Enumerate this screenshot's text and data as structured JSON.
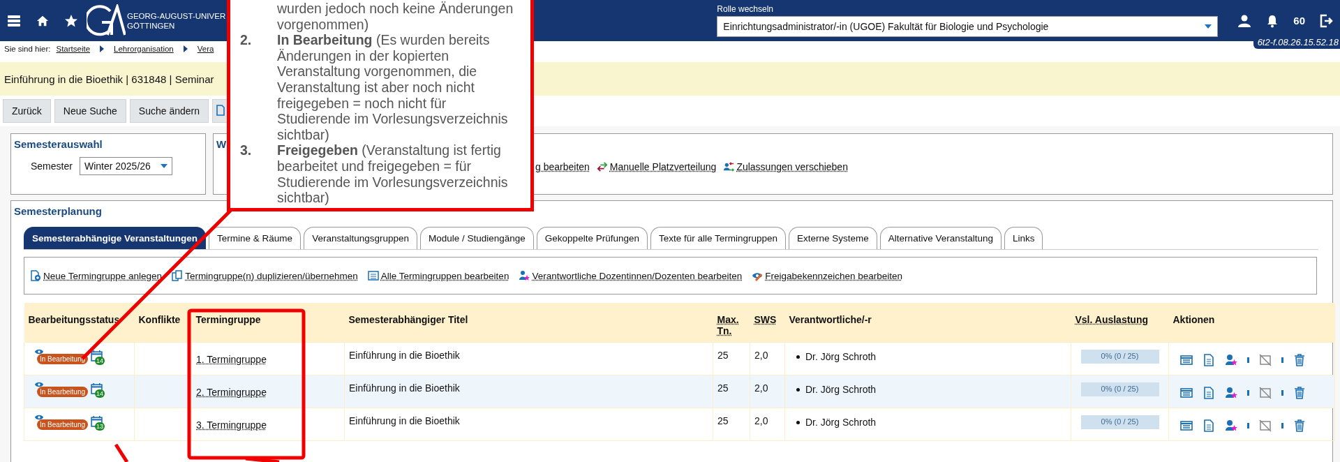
{
  "header": {
    "university_lines": [
      "GEORG-AUGUST-UNIVER",
      "GÖTTINGEN"
    ],
    "role_label": "Rolle wechseln",
    "role_value": "Einrichtungsadministrator/-in (UGOE) Fakultät für Biologie und Psychologie",
    "notification_count": "60",
    "version": "6t2-f.08.26.15.52.18"
  },
  "breadcrumb": {
    "label": "Sie sind hier:",
    "items": [
      "Startseite",
      "Lehrorganisation",
      "Vera"
    ]
  },
  "title": "Einführung in die Bioethik | 631848 | Seminar",
  "buttons": [
    "Zurück",
    "Neue Suche",
    "Suche ändern"
  ],
  "semester_box": {
    "title": "Semesterauswahl",
    "label": "Semester",
    "value": "Winter 2025/26"
  },
  "second_box": {
    "title": "W",
    "links": [
      {
        "label": "g bearbeiten",
        "kind": "plain"
      },
      {
        "label": "Manuelle Platzverteilung",
        "kind": "swap"
      },
      {
        "label": "Zulassungen verschieben",
        "kind": "move"
      }
    ]
  },
  "planning": {
    "title": "Semesterplanung",
    "tabs": [
      {
        "label": "Semesterabhängige Veranstaltungen",
        "selected": true
      },
      {
        "label": "Termine & Räume",
        "selected": false
      },
      {
        "label": "Veranstaltungsgruppen",
        "selected": false
      },
      {
        "label": "Module / Studiengänge",
        "selected": false
      },
      {
        "label": "Gekoppelte Prüfungen",
        "selected": false
      },
      {
        "label": "Texte für alle Termingruppen",
        "selected": false
      },
      {
        "label": "Externe Systeme",
        "selected": false
      },
      {
        "label": "Alternative Veranstaltung",
        "selected": false
      },
      {
        "label": "Links",
        "selected": false
      }
    ],
    "actions": [
      {
        "label": "Neue Termingruppe anlegen",
        "kind": "new"
      },
      {
        "label": "Termingruppe(n) duplizieren/übernehmen",
        "kind": "copy"
      },
      {
        "label": "Alle Termingruppen bearbeiten",
        "kind": "list"
      },
      {
        "label": "Verantwortliche Dozentinnen/Dozenten bearbeiten",
        "kind": "person"
      },
      {
        "label": "Freigabekennzeichen bearbeiten",
        "kind": "release"
      }
    ]
  },
  "table": {
    "columns": [
      {
        "label": "Bearbeitungsstatus",
        "abbr": false
      },
      {
        "label": "Konflikte",
        "abbr": false
      },
      {
        "label": "Termingruppe",
        "abbr": false
      },
      {
        "label": "Semesterabhängiger Titel",
        "abbr": false
      },
      {
        "label": "Max. Tn.",
        "abbr": true
      },
      {
        "label": "SWS",
        "abbr": true
      },
      {
        "label": "Verantwortliche/-r",
        "abbr": false
      },
      {
        "label": "Vsl. Auslastung",
        "abbr": true
      },
      {
        "label": "Aktionen",
        "abbr": false
      }
    ],
    "rows": [
      {
        "status": "In Bearbeitung",
        "dates": "14",
        "group": "1. Termingruppe",
        "title": "Einführung in die Bioethik",
        "max": "25",
        "sws": "2,0",
        "person": "Dr. Jörg Schroth",
        "load": "0% (0 / 25)",
        "level": 0
      },
      {
        "status": "In Bearbeitung",
        "dates": "14",
        "group": "2. Termingruppe",
        "title": "Einführung in die Bioethik",
        "max": "25",
        "sws": "2,0",
        "person": "Dr. Jörg Schroth",
        "load": "0% (0 / 25)",
        "level": 0
      },
      {
        "status": "In Bearbeitung",
        "dates": "13",
        "group": "3. Termingruppe",
        "title": "Einführung in die Bioethik",
        "max": "25",
        "sws": "2,0",
        "person": "Dr. Jörg Schroth",
        "load": "0% (0 / 25)",
        "level": 0
      }
    ]
  },
  "callout": {
    "items": [
      {
        "text": "wurden jedoch noch keine Änderungen vorgenommen)"
      },
      {
        "number": "2.",
        "text": "**In Bearbeitung** (Es wurden bereits Änderungen in der kopierten Veranstaltung vorgenommen, die Veranstaltung ist aber noch nicht freigegeben = noch nicht für Studierende im Vorlesungsverzeichnis sichtbar)"
      },
      {
        "number": "3.",
        "text": "**Freigegeben** (Veranstaltung ist fertig bearbeitet und freigegeben = für Studierende im Vorlesungsverzeichnis sichtbar)"
      }
    ]
  }
}
